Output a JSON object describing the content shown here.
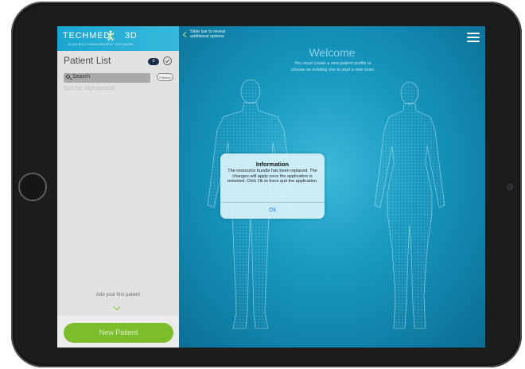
{
  "app": {
    "logo_text": "TECHMED",
    "logo_3d": "3D",
    "logo_tagline": "SCAN BODY MEASUREMENT SOFTWARE"
  },
  "sidebar": {
    "title": "Patient List",
    "patient_count": "0",
    "search_label": "Search",
    "filter_label": "Filtering",
    "sort_label": "Sort by: Alphabetical",
    "empty_hint": "Add your first patient",
    "new_patient_label": "New Patient"
  },
  "main": {
    "slide_hint_line1": "Slide bar to reveal",
    "slide_hint_line2": "additional options",
    "welcome_title": "Welcome",
    "welcome_message": "You must create a new patient profile or choose an existing one to start a new scan."
  },
  "dialog": {
    "title": "Information",
    "message": "The ressource bundle has been replaced. The changes will apply once the application is restarted. Click Ok to force quit the application.",
    "ok_label": "Ok"
  },
  "colors": {
    "accent_green": "#7bbd2a",
    "header_blue": "#1aa5cf",
    "background_blue": "#1799c0",
    "ok_blue": "#1a7ff0"
  },
  "icons": [
    "menu-icon",
    "search-icon",
    "check-icon",
    "chevron-down-icon",
    "back-chevron-icon"
  ]
}
